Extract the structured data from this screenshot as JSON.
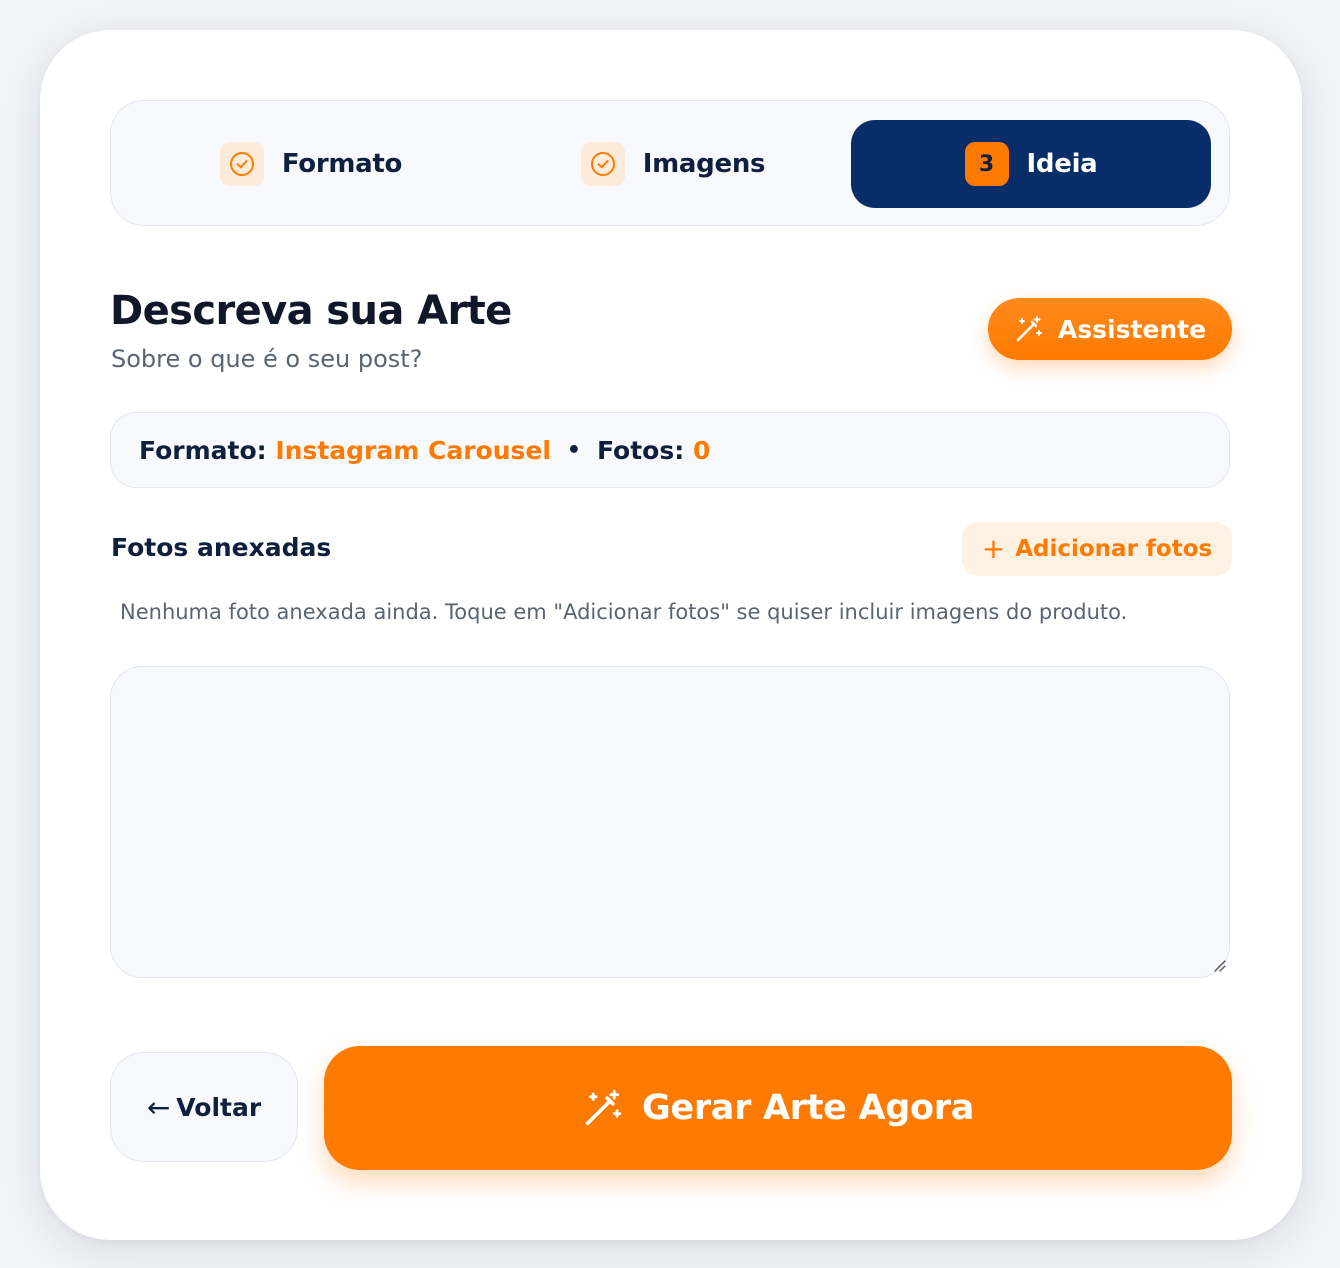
{
  "stepper": {
    "steps": [
      {
        "label": "Formato",
        "state": "done",
        "icon": "check-circle-icon"
      },
      {
        "label": "Imagens",
        "state": "done",
        "icon": "check-circle-icon"
      },
      {
        "label": "Ideia",
        "state": "active",
        "number": "3"
      }
    ]
  },
  "header": {
    "title": "Descreva sua Arte",
    "subtitle": "Sobre o que é o seu post?",
    "assistant_label": "Assistente"
  },
  "summary": {
    "format_label": "Formato:",
    "format_value": "Instagram Carousel",
    "separator": "•",
    "photos_label": "Fotos:",
    "photos_value": "0"
  },
  "photos": {
    "section_label": "Fotos anexadas",
    "add_label": "Adicionar fotos",
    "add_icon": "+",
    "empty_message": "Nenhuma foto anexada ainda. Toque em \"Adicionar fotos\" se quiser incluir imagens do produto."
  },
  "description": {
    "value": "",
    "placeholder": ""
  },
  "actions": {
    "back_arrow": "←",
    "back_label": "Voltar",
    "generate_label": "Gerar Arte Agora"
  },
  "colors": {
    "accent": "#ff7a00",
    "navy": "#082d68",
    "text_dark": "#0f1f3d",
    "muted": "#5b6472"
  }
}
